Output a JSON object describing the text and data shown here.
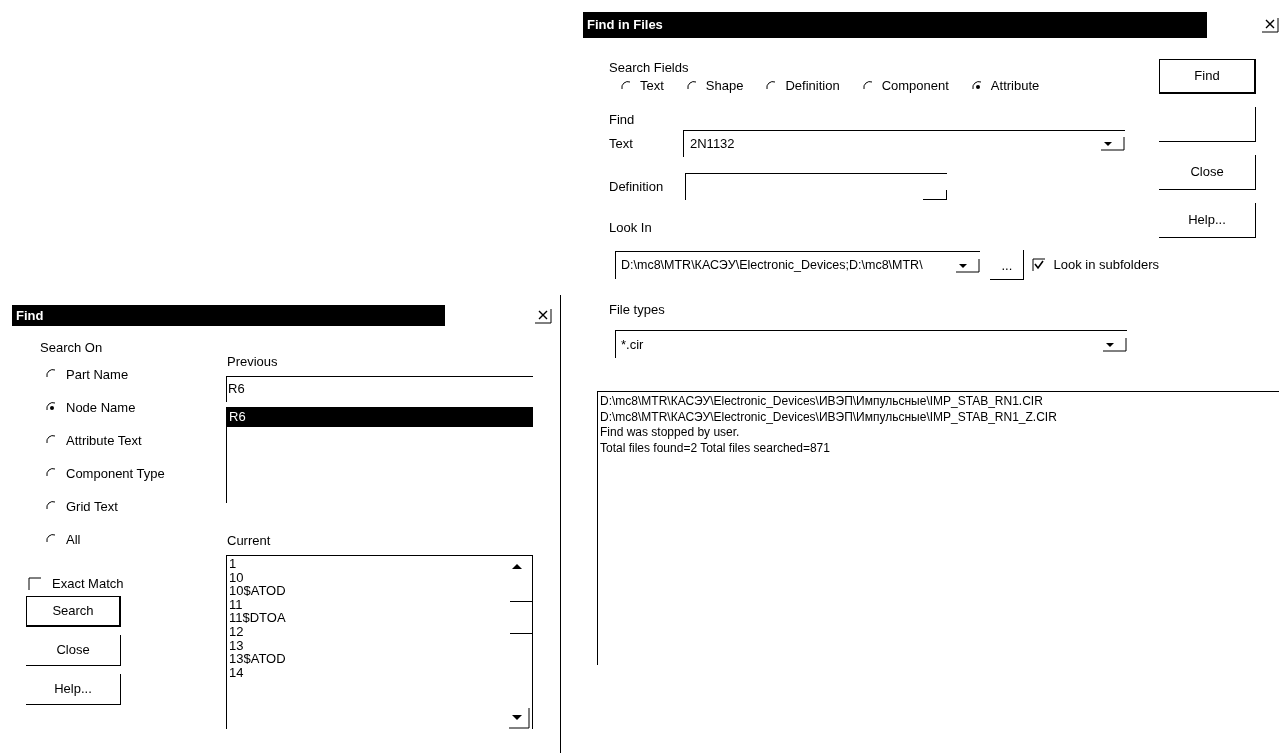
{
  "find_dialog": {
    "title": "Find",
    "search_on_label": "Search On",
    "options": [
      {
        "label": "Part Name",
        "selected": false
      },
      {
        "label": "Node Name",
        "selected": true
      },
      {
        "label": "Attribute Text",
        "selected": false
      },
      {
        "label": "Component Type",
        "selected": false
      },
      {
        "label": "Grid Text",
        "selected": false
      },
      {
        "label": "All",
        "selected": false
      }
    ],
    "exact_match": {
      "label": "Exact Match",
      "checked": false
    },
    "buttons": [
      {
        "label": "Search",
        "default": true
      },
      {
        "label": "Close",
        "default": false
      },
      {
        "label": "Help...",
        "default": false
      }
    ],
    "previous_label": "Previous",
    "previous_value": "R6",
    "previous_items": [
      {
        "text": "R6",
        "selected": true
      }
    ],
    "current_label": "Current",
    "current_items": [
      "1",
      "10",
      "10$ATOD",
      "11",
      "11$DTOA",
      "12",
      "13",
      "13$ATOD",
      "14"
    ]
  },
  "find_in_files": {
    "title": "Find in Files",
    "search_fields_label": "Search Fields",
    "fields": [
      {
        "label": "Text",
        "selected": false
      },
      {
        "label": "Shape",
        "selected": false
      },
      {
        "label": "Definition",
        "selected": false
      },
      {
        "label": "Component",
        "selected": false
      },
      {
        "label": "Attribute",
        "selected": true
      }
    ],
    "find_label": "Find",
    "text_label": "Text",
    "text_value": "2N1132",
    "definition_label": "Definition",
    "look_in_label": "Look In",
    "look_in_value": "D:\\mc8\\MTR\\КАСЭУ\\Electronic_Devices;D:\\mc8\\MTR\\",
    "browse_button": "...",
    "subfolders": {
      "label": "Look in subfolders",
      "checked": true
    },
    "file_types_label": "File types",
    "file_types_value": "*.cir",
    "buttons": [
      {
        "label": "Find",
        "default": true
      },
      {
        "label": "Close",
        "default": false
      },
      {
        "label": "Help...",
        "default": false
      }
    ],
    "results": [
      "D:\\mc8\\MTR\\КАСЭУ\\Electronic_Devices\\ИВЭП\\Импульсные\\IMP_STAB_RN1.CIR",
      "D:\\mc8\\MTR\\КАСЭУ\\Electronic_Devices\\ИВЭП\\Импульсные\\IMP_STAB_RN1_Z.CIR",
      "Find was stopped by user.",
      "Total files found=2 Total files searched=871"
    ]
  }
}
